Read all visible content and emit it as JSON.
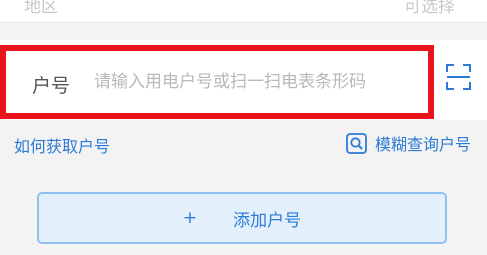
{
  "top_row": {
    "left_text": "地区",
    "right_text": "可选择"
  },
  "account_row": {
    "label": "户号",
    "placeholder": "请输入用电户号或扫一扫电表条形码",
    "value": "",
    "scan_icon": "scan-icon"
  },
  "links": {
    "how_to_get": "如何获取户号",
    "fuzzy_search": "模糊查询户号",
    "fuzzy_icon": "search-icon"
  },
  "add_button": {
    "plus": "+",
    "label": "添加户号"
  },
  "colors": {
    "highlight": "#e8141c",
    "link": "#2d7bd6",
    "button_bg": "#e3f0fb",
    "button_border": "#8fc0ee"
  }
}
